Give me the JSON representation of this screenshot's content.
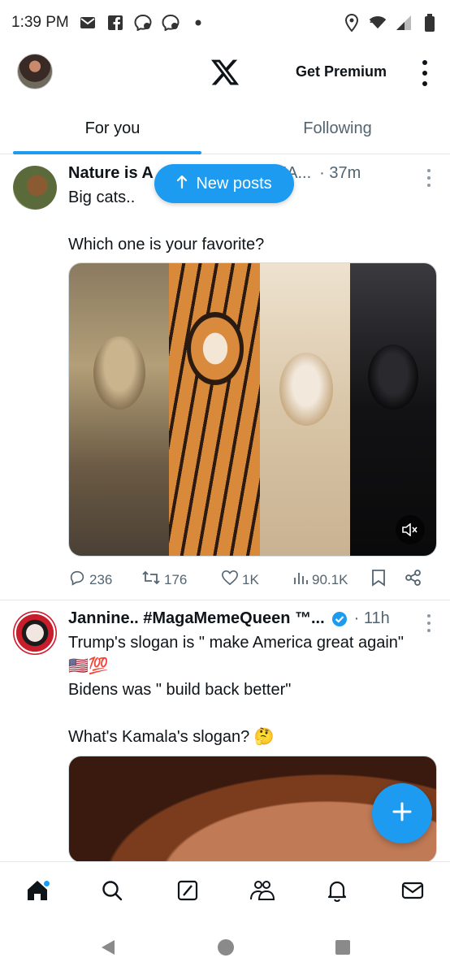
{
  "status_bar": {
    "time": "1:39 PM",
    "left_icons": [
      "mail-icon",
      "facebook-icon",
      "messenger-icon",
      "messenger-icon",
      "dot-icon"
    ],
    "right_icons": [
      "location-icon",
      "wifi-icon",
      "signal-icon",
      "battery-icon"
    ]
  },
  "header": {
    "logo": "x-logo-icon",
    "premium_label": "Get Premium"
  },
  "tabs": [
    {
      "label": "For you",
      "active": true
    },
    {
      "label": "Following",
      "active": false
    }
  ],
  "new_posts": {
    "label": "New posts"
  },
  "tweets": [
    {
      "name": "Nature is A",
      "handle": "@AMA...",
      "time": "· 37m",
      "text": "Big cats..\n\nWhich one is your favorite?",
      "stats": {
        "replies": "236",
        "reposts": "176",
        "likes": "1K",
        "views": "90.1K"
      }
    },
    {
      "name": "Jannine.. #MagaMemeQueen ™...",
      "time": "· 11h",
      "text_line1": "Trump's slogan is \" make America great again\"",
      "text_emoji": "🇺🇸💯",
      "text_line2": "Bidens was \" build back better\"",
      "text_line3": "What's Kamala's slogan? 🤔"
    }
  ],
  "bottom_nav": [
    "home-icon",
    "search-icon",
    "grok-icon",
    "communities-icon",
    "notifications-icon",
    "messages-icon"
  ],
  "colors": {
    "accent": "#1d9bf0",
    "text": "#0f1419",
    "muted": "#536471"
  }
}
